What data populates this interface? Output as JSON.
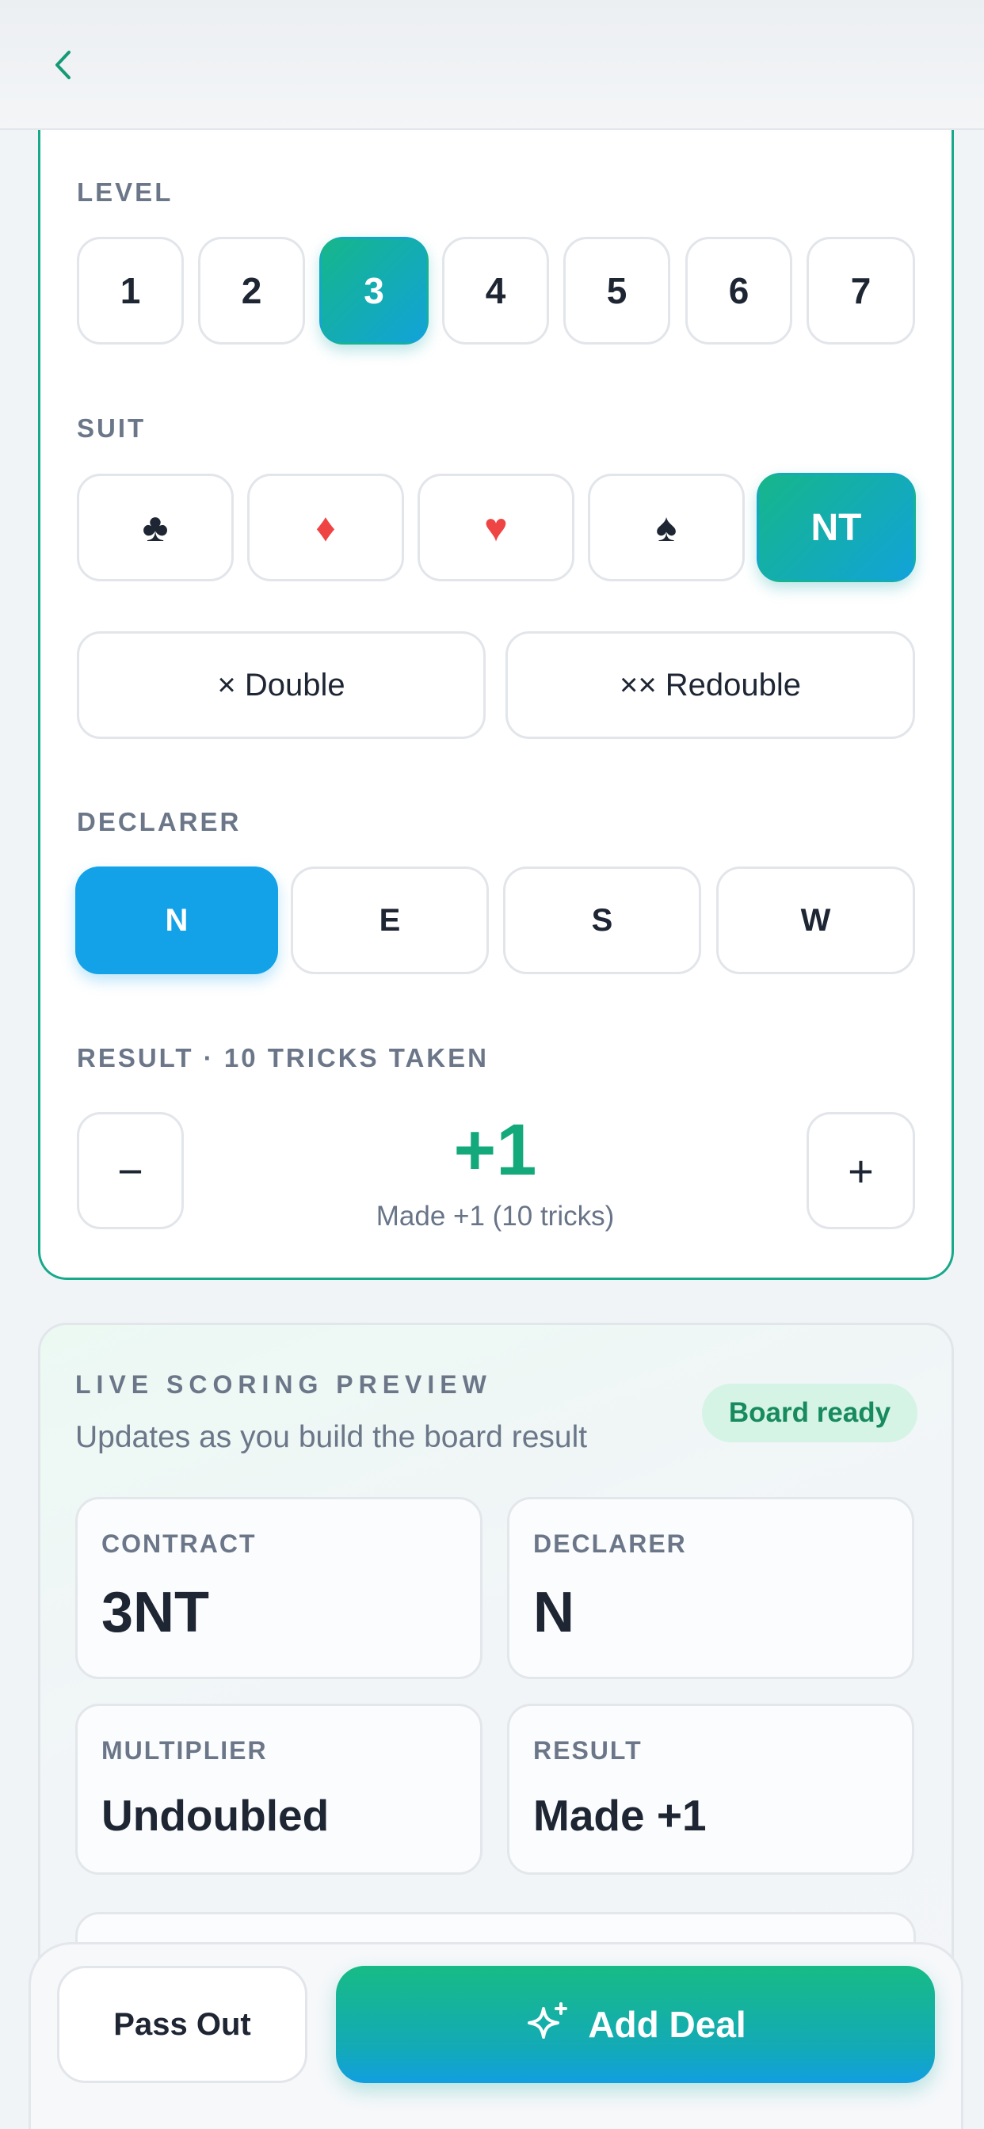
{
  "level": {
    "label": "LEVEL",
    "options": [
      "1",
      "2",
      "3",
      "4",
      "5",
      "6",
      "7"
    ],
    "selected": "3"
  },
  "suit": {
    "label": "SUIT",
    "options": [
      {
        "glyph": "♣",
        "icon": "club-icon",
        "color": "#1e2533"
      },
      {
        "glyph": "♦",
        "icon": "diamond-icon",
        "color": "#ef4444"
      },
      {
        "glyph": "♥",
        "icon": "heart-icon",
        "color": "#ef4444"
      },
      {
        "glyph": "♠",
        "icon": "spade-icon",
        "color": "#1e2533"
      },
      {
        "glyph": "NT",
        "icon": "",
        "color": "#ffffff"
      }
    ],
    "selected": "NT"
  },
  "multiplier_buttons": {
    "double": "× Double",
    "redouble": "×× Redouble"
  },
  "declarer": {
    "label": "DECLARER",
    "options": [
      "N",
      "E",
      "S",
      "W"
    ],
    "selected": "N"
  },
  "result": {
    "label": "RESULT · 10 TRICKS TAKEN",
    "value": "+1",
    "description": "Made +1 (10 tricks)",
    "minus": "−",
    "plus": "+"
  },
  "preview": {
    "title": "LIVE SCORING PREVIEW",
    "subtitle": "Updates as you build the board result",
    "badge": "Board ready",
    "stats": [
      {
        "label": "CONTRACT",
        "value": "3NT"
      },
      {
        "label": "DECLARER",
        "value": "N"
      },
      {
        "label": "MULTIPLIER",
        "value": "Undoubled"
      },
      {
        "label": "RESULT",
        "value": "Made +1"
      }
    ]
  },
  "actions": {
    "pass_out": "Pass Out",
    "add_deal": "Add Deal"
  },
  "colors": {
    "accent_green": "#16b68a",
    "accent_blue": "#13a2e8",
    "result_green": "#13a97a"
  }
}
